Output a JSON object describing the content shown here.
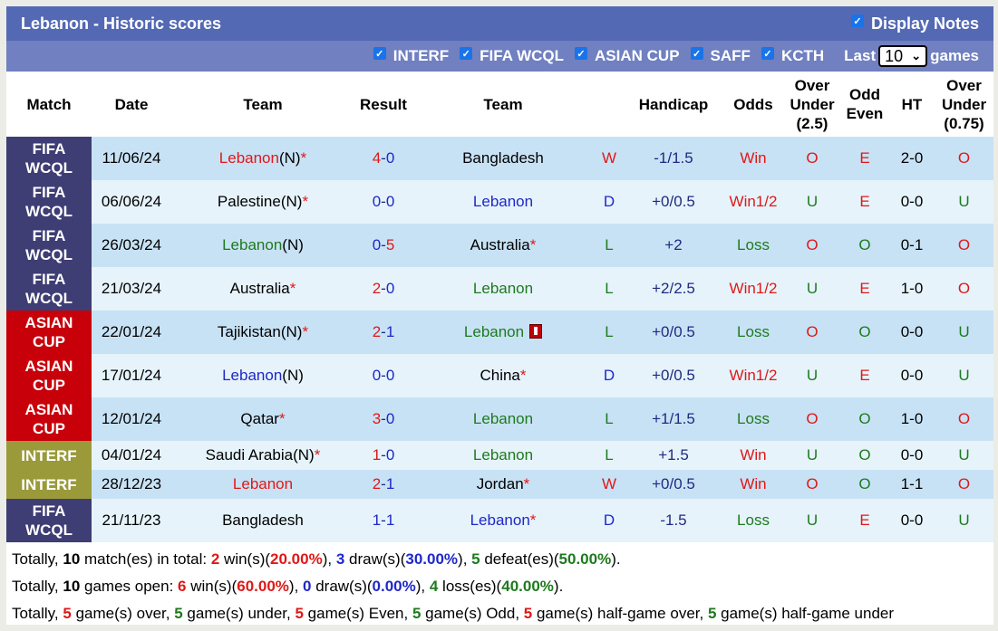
{
  "header": {
    "title": "Lebanon - Historic scores",
    "display_notes_label": "Display Notes",
    "display_notes_checked": true
  },
  "filters": {
    "items": [
      {
        "label": "INTERF",
        "checked": true
      },
      {
        "label": "FIFA WCQL",
        "checked": true
      },
      {
        "label": "ASIAN CUP",
        "checked": true
      },
      {
        "label": "SAFF",
        "checked": true
      },
      {
        "label": "KCTH",
        "checked": true
      }
    ],
    "last_label": "Last",
    "last_value": "10",
    "games_label": "games"
  },
  "columns": {
    "match": "Match",
    "date": "Date",
    "team1": "Team",
    "result": "Result",
    "team2": "Team",
    "handicap": "Handicap",
    "odds": "Odds",
    "ou_line1": "Over",
    "ou_line2": "Under",
    "ou_line3": "(2.5)",
    "oe_line1": "Odd",
    "oe_line2": "Even",
    "ht": "HT",
    "ou2_line1": "Over",
    "ou2_line2": "Under",
    "ou2_line3": "(0.75)"
  },
  "rows": [
    {
      "comp1": "FIFA",
      "comp2": "WCQL",
      "date": "11/06/24",
      "home": "Lebanon",
      "home_suffix": "(N)",
      "home_star": "*",
      "hg": "4",
      "ag": "0",
      "away": "Bangladesh",
      "away_star": "",
      "wdl": "W",
      "handicap": "-1/1.5",
      "odds": "Win",
      "ou": "O",
      "oe": "E",
      "ht": "2-0",
      "ou2": "O"
    },
    {
      "comp1": "FIFA",
      "comp2": "WCQL",
      "date": "06/06/24",
      "home": "Palestine",
      "home_suffix": "(N)",
      "home_star": "*",
      "hg": "0",
      "ag": "0",
      "away": "Lebanon",
      "away_star": "",
      "wdl": "D",
      "handicap": "+0/0.5",
      "odds": "Win1/2",
      "ou": "U",
      "oe": "E",
      "ht": "0-0",
      "ou2": "U"
    },
    {
      "comp1": "FIFA",
      "comp2": "WCQL",
      "date": "26/03/24",
      "home": "Lebanon",
      "home_suffix": "(N)",
      "home_star": "",
      "hg": "0",
      "ag": "5",
      "away": "Australia",
      "away_star": "*",
      "wdl": "L",
      "handicap": "+2",
      "odds": "Loss",
      "ou": "O",
      "oe": "O",
      "ht": "0-1",
      "ou2": "O"
    },
    {
      "comp1": "FIFA",
      "comp2": "WCQL",
      "date": "21/03/24",
      "home": "Australia",
      "home_suffix": "",
      "home_star": "*",
      "hg": "2",
      "ag": "0",
      "away": "Lebanon",
      "away_star": "",
      "wdl": "L",
      "handicap": "+2/2.5",
      "odds": "Win1/2",
      "ou": "U",
      "oe": "E",
      "ht": "1-0",
      "ou2": "O"
    },
    {
      "comp1": "ASIAN",
      "comp2": "CUP",
      "date": "22/01/24",
      "home": "Tajikistan",
      "home_suffix": "(N)",
      "home_star": "*",
      "hg": "2",
      "ag": "1",
      "away": "Lebanon",
      "away_star": "",
      "wdl": "L",
      "handicap": "+0/0.5",
      "odds": "Loss",
      "ou": "O",
      "oe": "O",
      "ht": "0-0",
      "ou2": "U"
    },
    {
      "comp1": "ASIAN",
      "comp2": "CUP",
      "date": "17/01/24",
      "home": "Lebanon",
      "home_suffix": "(N)",
      "home_star": "",
      "hg": "0",
      "ag": "0",
      "away": "China",
      "away_star": "*",
      "wdl": "D",
      "handicap": "+0/0.5",
      "odds": "Win1/2",
      "ou": "U",
      "oe": "E",
      "ht": "0-0",
      "ou2": "U"
    },
    {
      "comp1": "ASIAN",
      "comp2": "CUP",
      "date": "12/01/24",
      "home": "Qatar",
      "home_suffix": "",
      "home_star": "*",
      "hg": "3",
      "ag": "0",
      "away": "Lebanon",
      "away_star": "",
      "wdl": "L",
      "handicap": "+1/1.5",
      "odds": "Loss",
      "ou": "O",
      "oe": "O",
      "ht": "1-0",
      "ou2": "O"
    },
    {
      "comp1": "INTERF",
      "comp2": "",
      "date": "04/01/24",
      "home": "Saudi Arabia",
      "home_suffix": "(N)",
      "home_star": "*",
      "hg": "1",
      "ag": "0",
      "away": "Lebanon",
      "away_star": "",
      "wdl": "L",
      "handicap": "+1.5",
      "odds": "Win",
      "ou": "U",
      "oe": "O",
      "ht": "0-0",
      "ou2": "U"
    },
    {
      "comp1": "INTERF",
      "comp2": "",
      "date": "28/12/23",
      "home": "Lebanon",
      "home_suffix": "",
      "home_star": "",
      "hg": "2",
      "ag": "1",
      "away": "Jordan",
      "away_star": "*",
      "wdl": "W",
      "handicap": "+0/0.5",
      "odds": "Win",
      "ou": "O",
      "oe": "O",
      "ht": "1-1",
      "ou2": "O"
    },
    {
      "comp1": "FIFA",
      "comp2": "WCQL",
      "date": "21/11/23",
      "home": "Bangladesh",
      "home_suffix": "",
      "home_star": "",
      "hg": "1",
      "ag": "1",
      "away": "Lebanon",
      "away_star": "*",
      "wdl": "D",
      "handicap": "-1.5",
      "odds": "Loss",
      "ou": "U",
      "oe": "E",
      "ht": "0-0",
      "ou2": "U"
    }
  ],
  "summary": {
    "line1": {
      "prefix": "Totally, ",
      "total": "10",
      "t1": " match(es) in total: ",
      "wins": "2",
      "t2": " win(s)(",
      "win_pct": "20.00%",
      "t3": "), ",
      "draws": "3",
      "t4": " draw(s)(",
      "draw_pct": "30.00%",
      "t5": "), ",
      "defeats": "5",
      "t6": " defeat(es)(",
      "defeat_pct": "50.00%",
      "t7": ")."
    },
    "line2": {
      "prefix": "Totally, ",
      "total": "10",
      "t1": " games open: ",
      "wins": "6",
      "t2": " win(s)(",
      "win_pct": "60.00%",
      "t3": "), ",
      "draws": "0",
      "t4": " draw(s)(",
      "draw_pct": "0.00%",
      "t5": "), ",
      "losses": "4",
      "t6": " loss(es)(",
      "loss_pct": "40.00%",
      "t7": ")."
    },
    "line3": {
      "prefix": "Totally, ",
      "over": "5",
      "t1": " game(s) over, ",
      "under": "5",
      "t2": " game(s) under, ",
      "even": "5",
      "t3": " game(s) Even, ",
      "odd": "5",
      "t4": " game(s) Odd, ",
      "hg_over": "5",
      "t5": " game(s) half-game over, ",
      "hg_under": "5",
      "t6": " game(s) half-game under"
    }
  }
}
